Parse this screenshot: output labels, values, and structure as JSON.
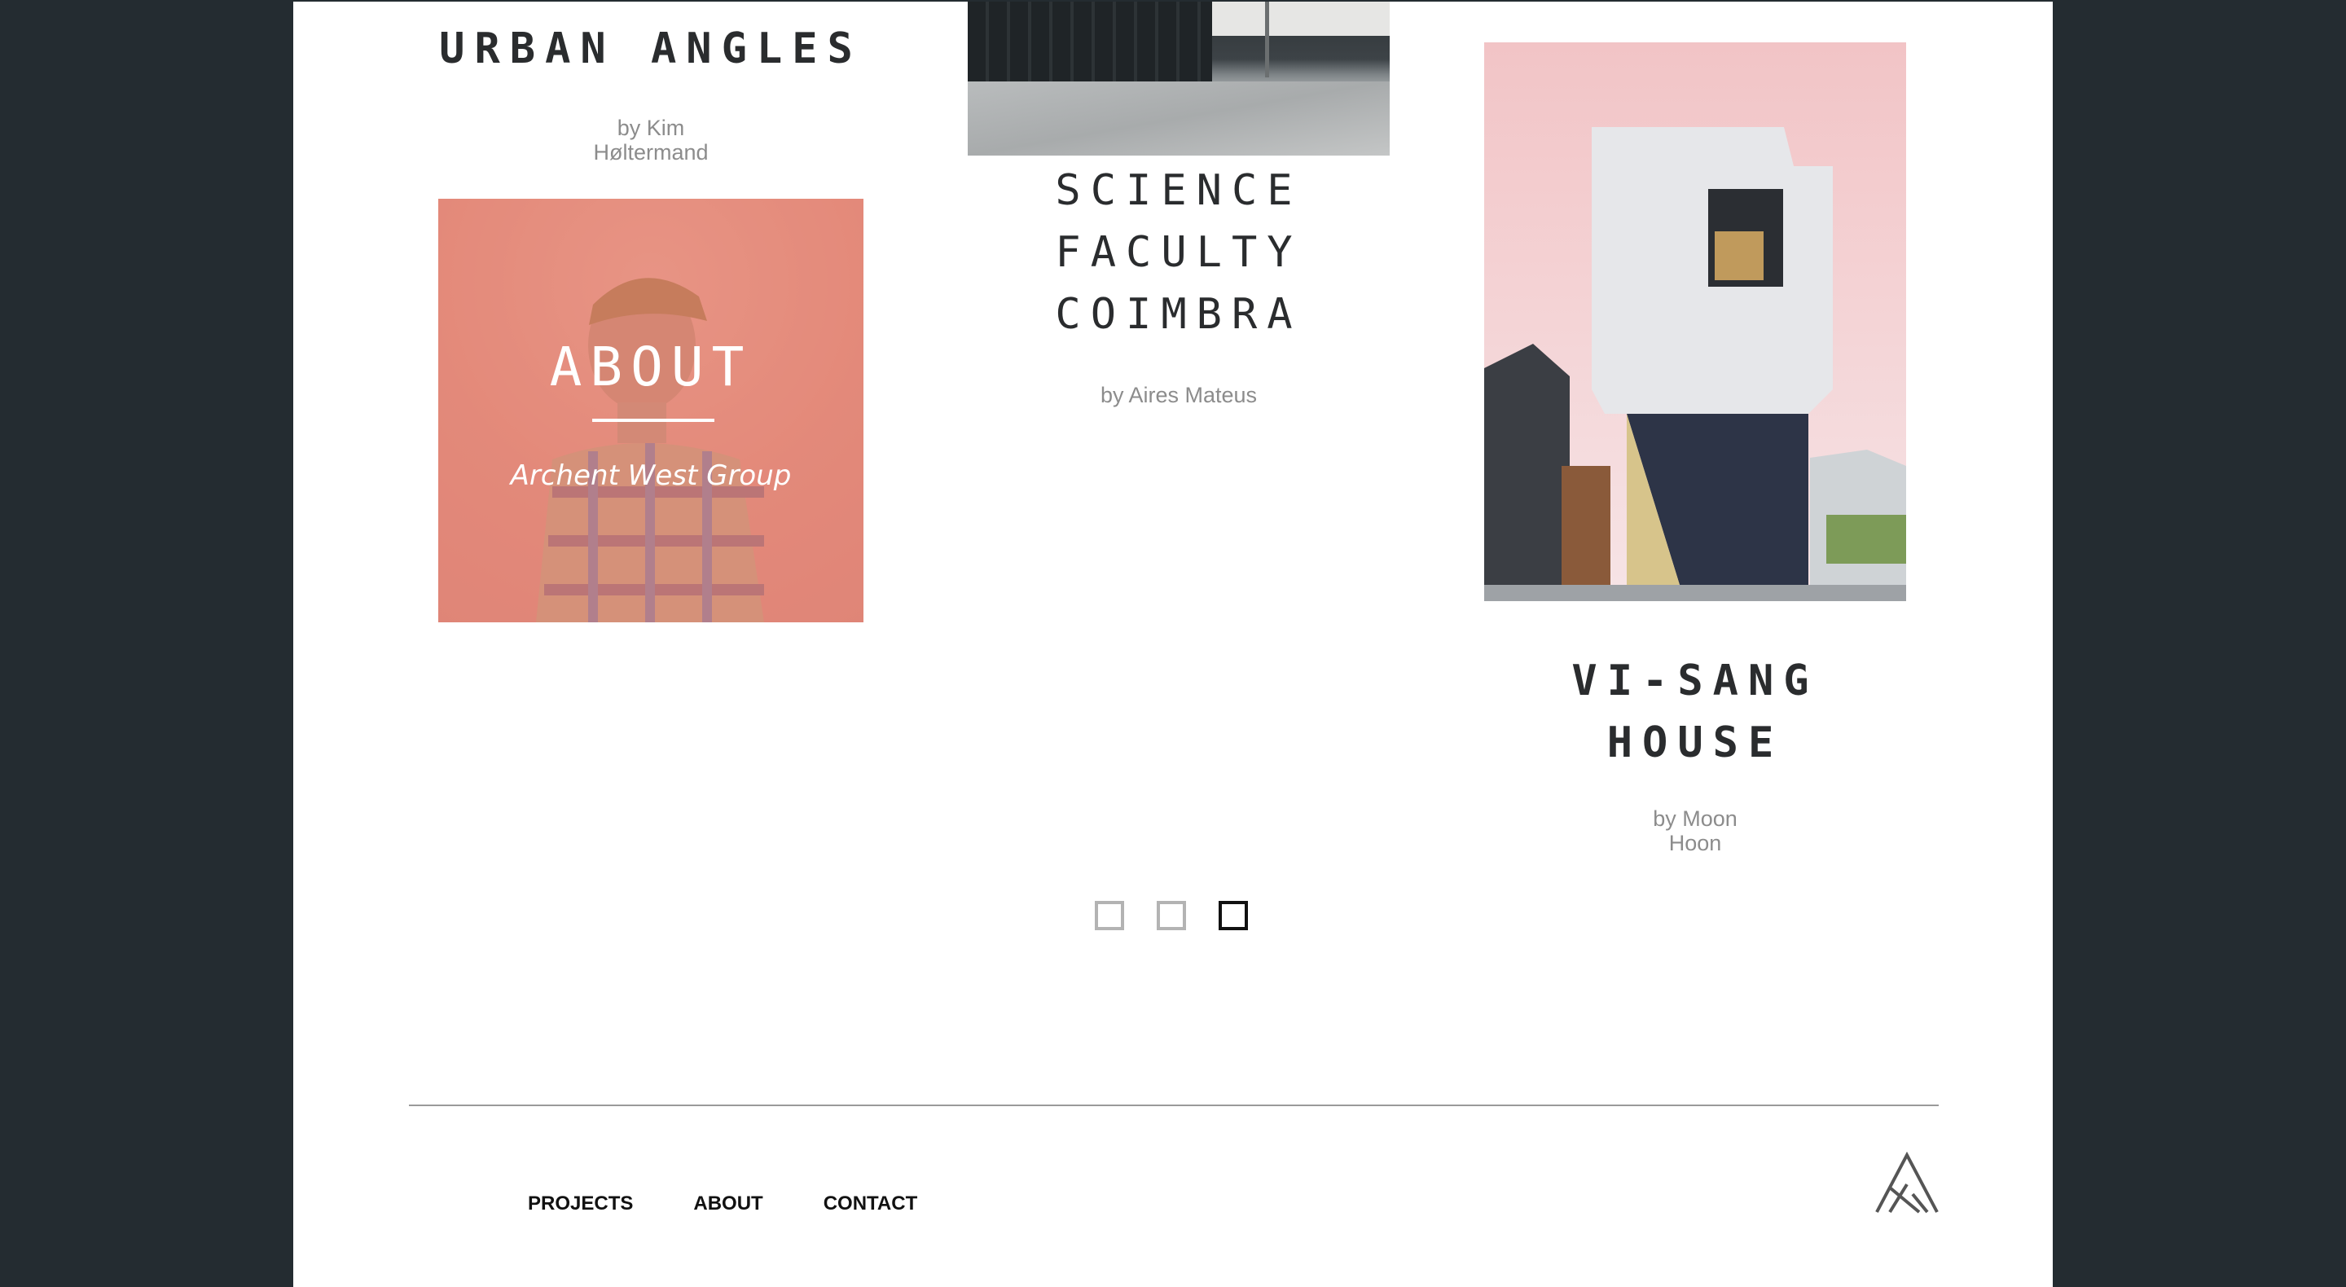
{
  "projects": [
    {
      "title": "URBAN ANGLES",
      "byline_prefix": "by Kim",
      "byline_suffix": "Høltermand"
    },
    {
      "title_line1": "SCIENCE FACULTY",
      "title_line2": "COIMBRA",
      "byline": "by Aires Mateus"
    },
    {
      "title": "VI-SANG HOUSE",
      "byline_prefix": "by Moon",
      "byline_suffix": "Hoon"
    }
  ],
  "about_tile": {
    "heading": "ABOUT",
    "subtitle": "Archent West Group"
  },
  "pagination": {
    "pages": 3,
    "active": 3
  },
  "footer": {
    "nav": [
      "PROJECTS",
      "ABOUT",
      "CONTACT"
    ],
    "logo_icon": "archent-logo-icon"
  },
  "colors": {
    "background": "#242c31",
    "page": "#ffffff",
    "title": "#2a2c2e",
    "byline": "#8c8c8c",
    "about_tint": "#e0907f"
  }
}
